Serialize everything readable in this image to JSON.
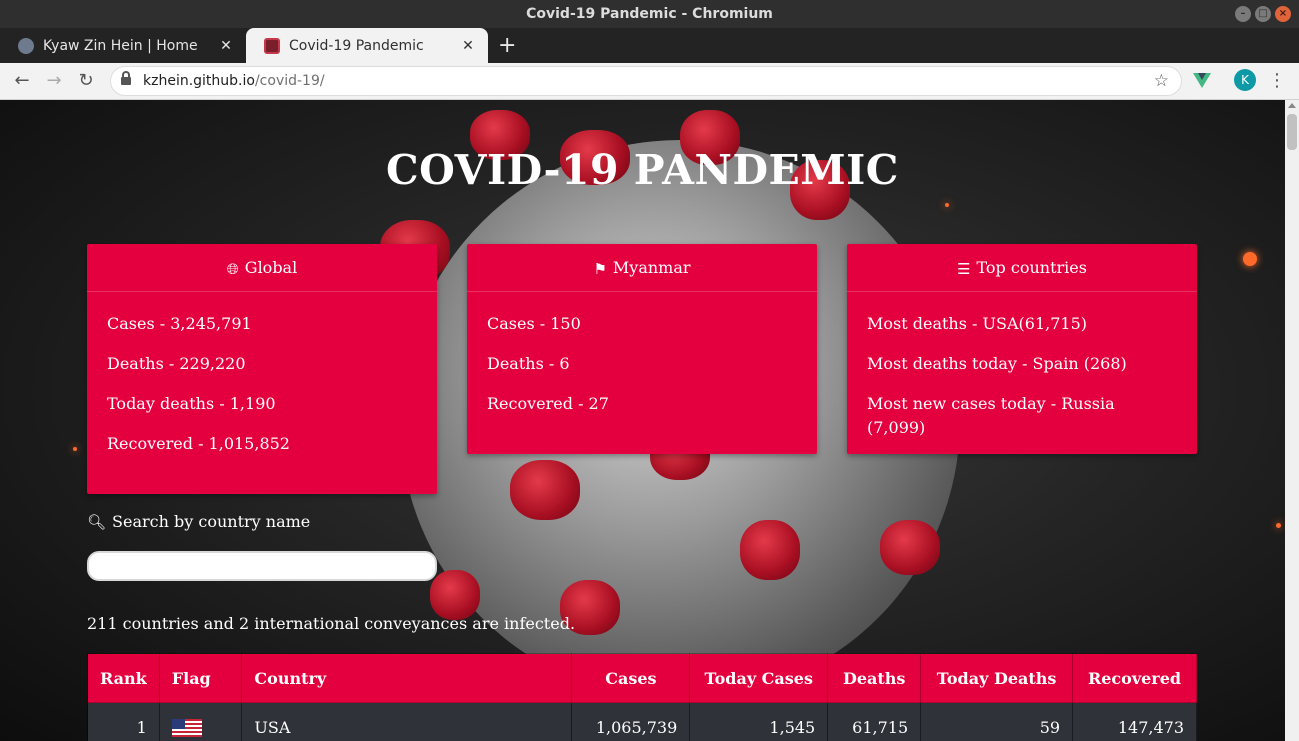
{
  "window": {
    "title": "Covid-19 Pandemic - Chromium"
  },
  "tabs": [
    {
      "label": "Kyaw Zin Hein | Home"
    },
    {
      "label": "Covid-19 Pandemic"
    }
  ],
  "address": {
    "domain": "kzhein.github.io",
    "path": "/covid-19/"
  },
  "profile": {
    "initial": "K"
  },
  "page": {
    "title": "COVID-19 PANDEMIC",
    "global": {
      "heading": "Global",
      "cases": "Cases - 3,245,791",
      "deaths": "Deaths - 229,220",
      "today_deaths": "Today deaths - 1,190",
      "recovered": "Recovered - 1,015,852"
    },
    "myanmar": {
      "heading": "Myanmar",
      "cases": "Cases - 150",
      "deaths": "Deaths - 6",
      "recovered": "Recovered - 27"
    },
    "top": {
      "heading": "Top countries",
      "most_deaths": "Most deaths - USA(61,715)",
      "most_deaths_today": "Most deaths today - Spain (268)",
      "most_new_cases": "Most new cases today - Russia (7,099)"
    },
    "search": {
      "label": "Search by country name",
      "value": ""
    },
    "summary": "211 countries and 2 international conveyances are infected.",
    "table": {
      "headers": {
        "rank": "Rank",
        "flag": "Flag",
        "country": "Country",
        "cases": "Cases",
        "today_cases": "Today Cases",
        "deaths": "Deaths",
        "today_deaths": "Today Deaths",
        "recovered": "Recovered"
      },
      "rows": [
        {
          "rank": "1",
          "country": "USA",
          "cases": "1,065,739",
          "today_cases": "1,545",
          "deaths": "61,715",
          "today_deaths": "59",
          "recovered": "147,473"
        }
      ]
    }
  },
  "colors": {
    "accent": "#e4003f",
    "table_row": "#2f3238",
    "omnibox": "#ffffff"
  }
}
